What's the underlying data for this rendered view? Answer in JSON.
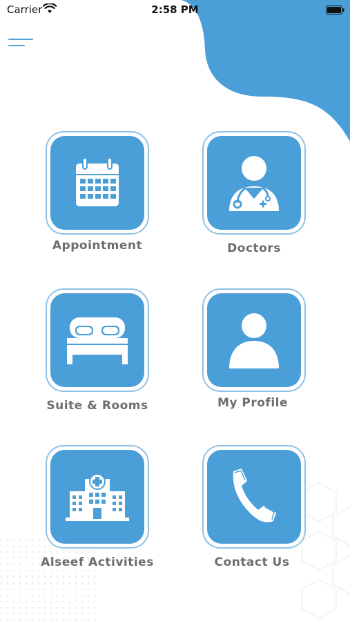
{
  "status_bar": {
    "carrier": "Carrier",
    "time": "2:58 PM"
  },
  "colors": {
    "accent": "#4a9fd8",
    "tile_border": "#8fc2e6",
    "label": "#6d6d6d"
  },
  "menu": {
    "icon": "hamburger-icon"
  },
  "tiles": [
    {
      "label": "Appointment",
      "icon": "calendar-icon"
    },
    {
      "label": "Doctors",
      "icon": "doctor-icon"
    },
    {
      "label": "Suite & Rooms",
      "icon": "bed-icon"
    },
    {
      "label": "My Profile",
      "icon": "user-icon"
    },
    {
      "label": "Alseef Activities",
      "icon": "hospital-icon"
    },
    {
      "label": "Contact Us",
      "icon": "phone-icon"
    }
  ]
}
